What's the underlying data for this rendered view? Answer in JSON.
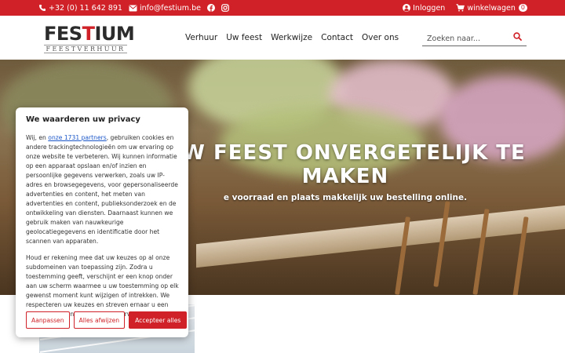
{
  "topbar": {
    "phone": "+32 (0) 11 642 891",
    "email": "info@festium.be",
    "login": "Inloggen",
    "cart_label": "winkelwagen",
    "cart_count": "0",
    "brand_color": "#cf2127"
  },
  "header": {
    "logo_word_a": "FES",
    "logo_word_t": "T",
    "logo_word_b": "IUM",
    "logo_sub": "FEESTVERHUUR",
    "nav": [
      "Verhuur",
      "Uw feest",
      "Werkwijze",
      "Contact",
      "Over ons"
    ],
    "search_placeholder": "Zoeken naar..."
  },
  "hero": {
    "title_line1": "UW FEEST ONVERGETELIJK TE",
    "title_line2": "MAKEN",
    "subtitle": "e voorraad en plaats makkelijk uw bestelling online."
  },
  "cookie": {
    "title": "We waarderen uw privacy",
    "p1_before": "Wij, en ",
    "p1_link": "onze 1731 partners",
    "p1_after": ", gebruiken cookies en andere trackingtechnologieën om uw ervaring op onze website te verbeteren. Wij kunnen informatie op een apparaat opslaan en/of inzien en persoonlijke gegevens verwerken, zoals uw IP-adres en browsegegevens, voor gepersonaliseerde advertenties en content, het meten van advertenties en content, publieksonderzoek en de ontwikkeling van diensten. Daarnaast kunnen we gebruik maken van nauwkeurige geolocatiegegevens en identificatie door het scannen van apparaten.",
    "p2": "Houd er rekening mee dat uw keuzes op al onze subdomeinen van toepassing zijn. Zodra u toestemming geeft, verschijnt er een knop onder aan uw scherm waarmee u uw toestemming op elk gewenst moment kunt wijzigen of intrekken. We respecteren uw keuzes en streven ernaar u een transparante en veilige browse-ervaring te bieden.",
    "btn_customize": "Aanpassen",
    "btn_reject": "Alles afwijzen",
    "btn_accept": "Accepteer alles"
  }
}
